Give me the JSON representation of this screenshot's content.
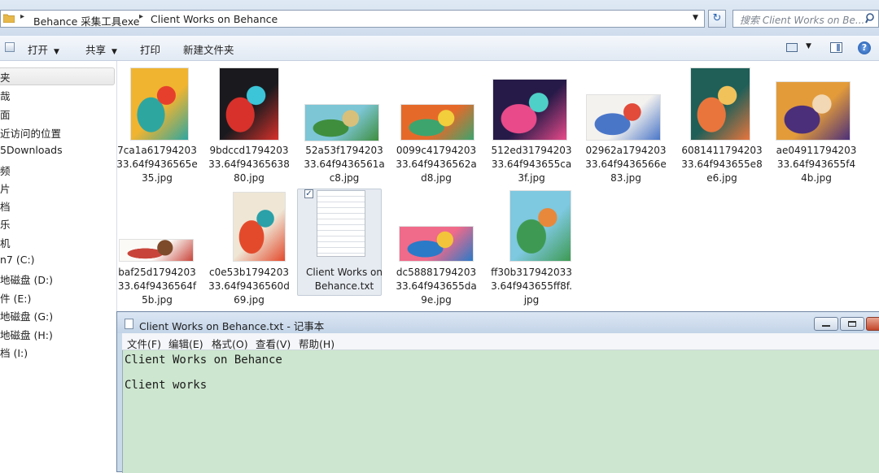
{
  "address_bar": {
    "crumbs": [
      "Behance 采集工具exe",
      "Client Works on Behance"
    ],
    "separator": "▸",
    "dropdown": "▼",
    "refresh": "↻",
    "search_placeholder": "搜索 Client Works on Be...",
    "search_icon": "magnifier-icon"
  },
  "toolbar": {
    "open_label": "打开",
    "share_label": "共享",
    "print_label": "打印",
    "new_folder_label": "新建文件夹",
    "caret": "▼",
    "help": "?"
  },
  "nav_pane": {
    "items": [
      {
        "label": "夹",
        "selected": true
      },
      {
        "label": "哉"
      },
      {
        "label": "面"
      },
      {
        "label": "近访问的位置"
      },
      {
        "label": "5Downloads"
      },
      {
        "label": "频"
      },
      {
        "label": "片"
      },
      {
        "label": "档"
      },
      {
        "label": "乐"
      },
      {
        "label": "机"
      },
      {
        "label": "n7 (C:)"
      },
      {
        "label": "地磁盘 (D:)"
      },
      {
        "label": "件 (E:)"
      },
      {
        "label": "地磁盘 (G:)"
      },
      {
        "label": "地磁盘 (H:)"
      },
      {
        "label": "档 (I:)"
      }
    ]
  },
  "files": [
    {
      "name": "7ca1a6179420333.64f9436565e35.jpg",
      "lines": [
        "7ca1a61794203",
        "33.64f9436565e",
        "35.jpg"
      ],
      "colors": [
        "#f0b431",
        "#2ea6a0",
        "#e6402c"
      ]
    },
    {
      "name": "9bdccd179420333.64f9436563880.jpg",
      "lines": [
        "9bdccd1794203",
        "33.64f94365638",
        "80.jpg"
      ],
      "colors": [
        "#1a1a1e",
        "#d8312b",
        "#3cc4d8"
      ]
    },
    {
      "name": "52a53f179420333.64f9436561ac8.jpg",
      "lines": [
        "52a53f1794203",
        "33.64f9436561a",
        "c8.jpg"
      ],
      "colors": [
        "#7cc6d6",
        "#3f8e3e",
        "#d8c07a"
      ]
    },
    {
      "name": "0099c4179420333.64f9436562ad8.jpg",
      "lines": [
        "0099c41794203",
        "33.64f9436562a",
        "d8.jpg"
      ],
      "colors": [
        "#e56a2a",
        "#3da46e",
        "#f2cd3c"
      ]
    },
    {
      "name": "512ed3179420333.64f943655ca3f.jpg",
      "lines": [
        "512ed31794203",
        "33.64f943655ca",
        "3f.jpg"
      ],
      "colors": [
        "#261a48",
        "#e84a8a",
        "#4ed0c8"
      ]
    },
    {
      "name": "02962a179420333.64f9436566e83.jpg",
      "lines": [
        "02962a1794203",
        "33.64f9436566e",
        "83.jpg"
      ],
      "colors": [
        "#f4f2ee",
        "#4a76c8",
        "#e24a3a"
      ]
    },
    {
      "name": "6081411794203 33.64f943655e8e6.jpg",
      "lines": [
        "6081411794203",
        "33.64f943655e8",
        "e6.jpg"
      ],
      "colors": [
        "#1f5f58",
        "#e9753c",
        "#f1c25a"
      ]
    },
    {
      "name": "ae04911794203 33.64f943655f44b.jpg",
      "lines": [
        "ae04911794203",
        "33.64f943655f4",
        "4b.jpg"
      ],
      "colors": [
        "#e39b3a",
        "#4b2f7a",
        "#f2d8b4"
      ]
    },
    {
      "name": "baf25d179420333.64f9436564f5b.jpg",
      "lines": [
        "baf25d1794203",
        "33.64f9436564f",
        "5b.jpg"
      ],
      "colors": [
        "#fbfaf7",
        "#c8443a",
        "#7d4a2a"
      ]
    },
    {
      "name": "c0e53b179420333.64f9436560d69.jpg",
      "lines": [
        "c0e53b1794203",
        "33.64f9436560d",
        "69.jpg"
      ],
      "colors": [
        "#efe6d5",
        "#e34a2c",
        "#2aa0a8"
      ]
    },
    {
      "name": "Client Works on Behance.txt",
      "lines": [
        "Client Works on",
        "Behance.txt"
      ],
      "selected": true,
      "checked": true
    },
    {
      "name": "dc588817942033 3.64f943655da9e.jpg",
      "lines": [
        "dc58881794203",
        "33.64f943655da",
        "9e.jpg"
      ],
      "colors": [
        "#f06a8a",
        "#2a7ac8",
        "#f3c43a"
      ]
    },
    {
      "name": "ff30b3179420333.64f943655ff8f.jpg",
      "lines": [
        "ff30b317942033",
        "3.64f943655ff8f.",
        "jpg"
      ],
      "colors": [
        "#7ec8e0",
        "#3e9a52",
        "#e8883a"
      ]
    }
  ],
  "notepad": {
    "title": "Client Works on Behance.txt - 记事本",
    "menu": [
      "文件(F)",
      "编辑(E)",
      "格式(O)",
      "查看(V)",
      "帮助(H)"
    ],
    "lines": [
      "Client Works on Behance",
      "",
      "Client works"
    ],
    "editor_bg": "#cde6cf"
  }
}
